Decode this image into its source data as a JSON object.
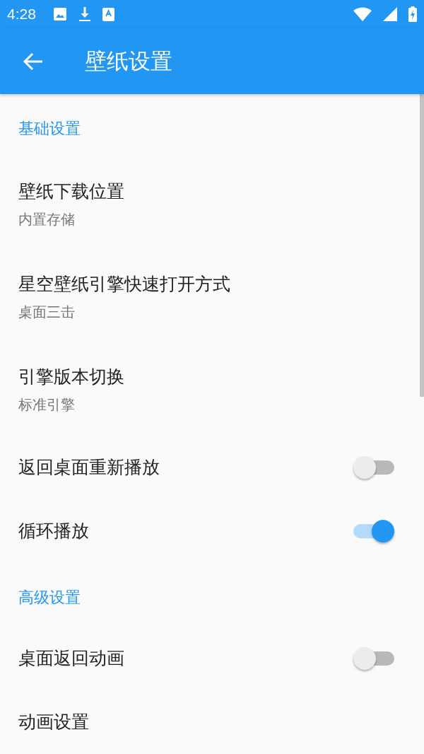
{
  "status_bar": {
    "time": "4:28"
  },
  "app_bar": {
    "title": "壁纸设置"
  },
  "items": [
    {
      "kind": "header",
      "title": "基础设置"
    },
    {
      "kind": "detail",
      "title": "壁纸下载位置",
      "subtitle": "内置存储"
    },
    {
      "kind": "detail",
      "title": "星空壁纸引擎快速打开方式",
      "subtitle": "桌面三击"
    },
    {
      "kind": "detail",
      "title": "引擎版本切换",
      "subtitle": "标准引擎"
    },
    {
      "kind": "toggle",
      "title": "返回桌面重新播放",
      "on": false
    },
    {
      "kind": "toggle",
      "title": "循环播放",
      "on": true
    },
    {
      "kind": "header",
      "title": "高级设置"
    },
    {
      "kind": "toggle",
      "title": "桌面返回动画",
      "on": false
    },
    {
      "kind": "plain",
      "title": "动画设置"
    }
  ]
}
